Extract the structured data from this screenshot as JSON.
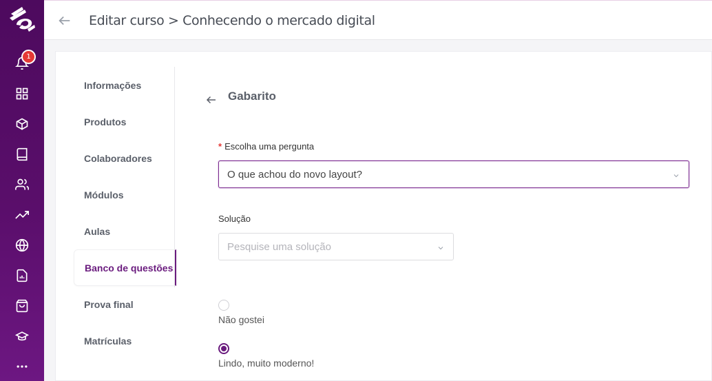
{
  "header": {
    "title": "Editar curso > Conhecendo o mercado digital"
  },
  "rail": {
    "notification_count": "1",
    "icons": [
      "bell-icon",
      "grid-icon",
      "box-icon",
      "book-icon",
      "users-icon",
      "trending-icon",
      "globe-icon",
      "report-icon",
      "shopping-bag-icon",
      "graduation-cap-icon",
      "more-icon"
    ]
  },
  "side_menu": {
    "items": [
      {
        "label": "Informações",
        "active": false
      },
      {
        "label": "Produtos",
        "active": false
      },
      {
        "label": "Colaboradores",
        "active": false
      },
      {
        "label": "Módulos",
        "active": false
      },
      {
        "label": "Aulas",
        "active": false
      },
      {
        "label": "Banco de questões",
        "active": true
      },
      {
        "label": "Prova final",
        "active": false
      },
      {
        "label": "Matrículas",
        "active": false
      }
    ]
  },
  "section": {
    "title": "Gabarito"
  },
  "form": {
    "question_label": "Escolha uma pergunta",
    "question_required_mark": "*",
    "question_value": "O que achou do novo layout?",
    "solution_label": "Solução",
    "solution_placeholder": "Pesquise uma solução",
    "options": [
      {
        "label": "Não gostei",
        "checked": false
      },
      {
        "label": "Lindo, muito moderno!",
        "checked": true
      }
    ]
  },
  "colors": {
    "brand_purple": "#5a0e6b",
    "accent": "#6a1b7e",
    "badge_red": "#e53935"
  }
}
